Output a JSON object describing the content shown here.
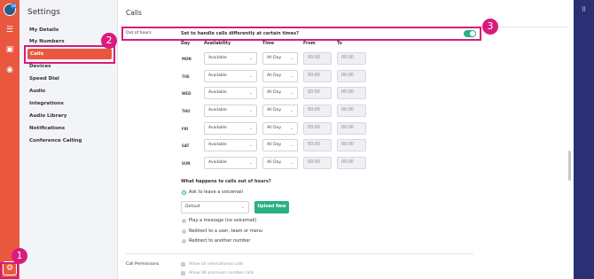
{
  "rail": {
    "badge": "48"
  },
  "sidebar": {
    "title": "Settings",
    "items": [
      {
        "label": "My Details"
      },
      {
        "label": "My Numbers"
      },
      {
        "label": "Calls"
      },
      {
        "label": "Devices"
      },
      {
        "label": "Speed Dial"
      },
      {
        "label": "Audio"
      },
      {
        "label": "Integrations"
      },
      {
        "label": "Audio Library"
      },
      {
        "label": "Notifications"
      },
      {
        "label": "Conference Calling"
      }
    ]
  },
  "main": {
    "title": "Calls",
    "out_of_hours": {
      "label": "Out of hours",
      "question": "Set to handle calls differently at certain times?",
      "toggle_on": true
    },
    "columns": [
      "Day",
      "Availability",
      "Time",
      "From",
      "To"
    ],
    "rows": [
      {
        "day": "MON",
        "availability": "Available",
        "time": "All Day",
        "from": "00:00",
        "to": "00:00"
      },
      {
        "day": "TUE",
        "availability": "Available",
        "time": "All Day",
        "from": "00:00",
        "to": "00:00"
      },
      {
        "day": "WED",
        "availability": "Available",
        "time": "All Day",
        "from": "00:00",
        "to": "00:00"
      },
      {
        "day": "THU",
        "availability": "Available",
        "time": "All Day",
        "from": "00:00",
        "to": "00:00"
      },
      {
        "day": "FRI",
        "availability": "Available",
        "time": "All Day",
        "from": "00:00",
        "to": "00:00"
      },
      {
        "day": "SAT",
        "availability": "Available",
        "time": "All Day",
        "from": "00:00",
        "to": "00:00"
      },
      {
        "day": "SUN",
        "availability": "Available",
        "time": "All Day",
        "from": "00:00",
        "to": "00:00"
      }
    ],
    "after_hours": {
      "question": "What happens to calls out of hours?",
      "options": [
        {
          "label": "Ask to leave a voicemail",
          "selected": true
        },
        {
          "label": "Play a message (no voicemail)",
          "selected": false
        },
        {
          "label": "Redirect to a user, team or menu",
          "selected": false
        },
        {
          "label": "Redirect to another number",
          "selected": false
        }
      ],
      "voicemail_select": "Default",
      "upload_button": "Upload New"
    },
    "call_permissions": {
      "label": "Call Permissions",
      "options": [
        {
          "label": "Allow all international calls"
        },
        {
          "label": "Allow UK premium number calls"
        }
      ]
    }
  },
  "annotations": {
    "steps": [
      "1",
      "2",
      "3"
    ],
    "color": "#d81b7c"
  },
  "colors": {
    "brand": "#e9573f",
    "accent_green": "#2ab07f",
    "navy": "#2b2f73"
  }
}
